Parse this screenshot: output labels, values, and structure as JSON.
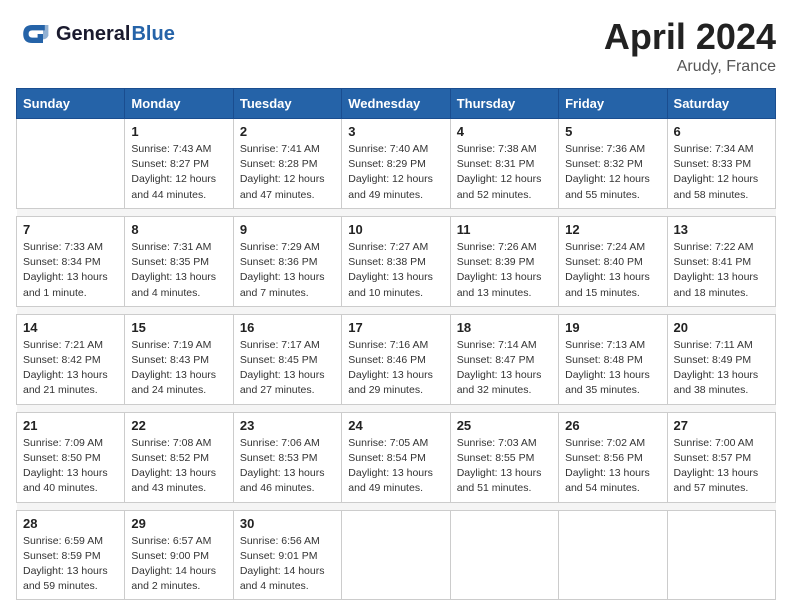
{
  "header": {
    "logo_line1": "General",
    "logo_line2": "Blue",
    "month_year": "April 2024",
    "location": "Arudy, France"
  },
  "weekdays": [
    "Sunday",
    "Monday",
    "Tuesday",
    "Wednesday",
    "Thursday",
    "Friday",
    "Saturday"
  ],
  "weeks": [
    [
      {
        "day": "",
        "sunrise": "",
        "sunset": "",
        "daylight": ""
      },
      {
        "day": "1",
        "sunrise": "Sunrise: 7:43 AM",
        "sunset": "Sunset: 8:27 PM",
        "daylight": "Daylight: 12 hours and 44 minutes."
      },
      {
        "day": "2",
        "sunrise": "Sunrise: 7:41 AM",
        "sunset": "Sunset: 8:28 PM",
        "daylight": "Daylight: 12 hours and 47 minutes."
      },
      {
        "day": "3",
        "sunrise": "Sunrise: 7:40 AM",
        "sunset": "Sunset: 8:29 PM",
        "daylight": "Daylight: 12 hours and 49 minutes."
      },
      {
        "day": "4",
        "sunrise": "Sunrise: 7:38 AM",
        "sunset": "Sunset: 8:31 PM",
        "daylight": "Daylight: 12 hours and 52 minutes."
      },
      {
        "day": "5",
        "sunrise": "Sunrise: 7:36 AM",
        "sunset": "Sunset: 8:32 PM",
        "daylight": "Daylight: 12 hours and 55 minutes."
      },
      {
        "day": "6",
        "sunrise": "Sunrise: 7:34 AM",
        "sunset": "Sunset: 8:33 PM",
        "daylight": "Daylight: 12 hours and 58 minutes."
      }
    ],
    [
      {
        "day": "7",
        "sunrise": "Sunrise: 7:33 AM",
        "sunset": "Sunset: 8:34 PM",
        "daylight": "Daylight: 13 hours and 1 minute."
      },
      {
        "day": "8",
        "sunrise": "Sunrise: 7:31 AM",
        "sunset": "Sunset: 8:35 PM",
        "daylight": "Daylight: 13 hours and 4 minutes."
      },
      {
        "day": "9",
        "sunrise": "Sunrise: 7:29 AM",
        "sunset": "Sunset: 8:36 PM",
        "daylight": "Daylight: 13 hours and 7 minutes."
      },
      {
        "day": "10",
        "sunrise": "Sunrise: 7:27 AM",
        "sunset": "Sunset: 8:38 PM",
        "daylight": "Daylight: 13 hours and 10 minutes."
      },
      {
        "day": "11",
        "sunrise": "Sunrise: 7:26 AM",
        "sunset": "Sunset: 8:39 PM",
        "daylight": "Daylight: 13 hours and 13 minutes."
      },
      {
        "day": "12",
        "sunrise": "Sunrise: 7:24 AM",
        "sunset": "Sunset: 8:40 PM",
        "daylight": "Daylight: 13 hours and 15 minutes."
      },
      {
        "day": "13",
        "sunrise": "Sunrise: 7:22 AM",
        "sunset": "Sunset: 8:41 PM",
        "daylight": "Daylight: 13 hours and 18 minutes."
      }
    ],
    [
      {
        "day": "14",
        "sunrise": "Sunrise: 7:21 AM",
        "sunset": "Sunset: 8:42 PM",
        "daylight": "Daylight: 13 hours and 21 minutes."
      },
      {
        "day": "15",
        "sunrise": "Sunrise: 7:19 AM",
        "sunset": "Sunset: 8:43 PM",
        "daylight": "Daylight: 13 hours and 24 minutes."
      },
      {
        "day": "16",
        "sunrise": "Sunrise: 7:17 AM",
        "sunset": "Sunset: 8:45 PM",
        "daylight": "Daylight: 13 hours and 27 minutes."
      },
      {
        "day": "17",
        "sunrise": "Sunrise: 7:16 AM",
        "sunset": "Sunset: 8:46 PM",
        "daylight": "Daylight: 13 hours and 29 minutes."
      },
      {
        "day": "18",
        "sunrise": "Sunrise: 7:14 AM",
        "sunset": "Sunset: 8:47 PM",
        "daylight": "Daylight: 13 hours and 32 minutes."
      },
      {
        "day": "19",
        "sunrise": "Sunrise: 7:13 AM",
        "sunset": "Sunset: 8:48 PM",
        "daylight": "Daylight: 13 hours and 35 minutes."
      },
      {
        "day": "20",
        "sunrise": "Sunrise: 7:11 AM",
        "sunset": "Sunset: 8:49 PM",
        "daylight": "Daylight: 13 hours and 38 minutes."
      }
    ],
    [
      {
        "day": "21",
        "sunrise": "Sunrise: 7:09 AM",
        "sunset": "Sunset: 8:50 PM",
        "daylight": "Daylight: 13 hours and 40 minutes."
      },
      {
        "day": "22",
        "sunrise": "Sunrise: 7:08 AM",
        "sunset": "Sunset: 8:52 PM",
        "daylight": "Daylight: 13 hours and 43 minutes."
      },
      {
        "day": "23",
        "sunrise": "Sunrise: 7:06 AM",
        "sunset": "Sunset: 8:53 PM",
        "daylight": "Daylight: 13 hours and 46 minutes."
      },
      {
        "day": "24",
        "sunrise": "Sunrise: 7:05 AM",
        "sunset": "Sunset: 8:54 PM",
        "daylight": "Daylight: 13 hours and 49 minutes."
      },
      {
        "day": "25",
        "sunrise": "Sunrise: 7:03 AM",
        "sunset": "Sunset: 8:55 PM",
        "daylight": "Daylight: 13 hours and 51 minutes."
      },
      {
        "day": "26",
        "sunrise": "Sunrise: 7:02 AM",
        "sunset": "Sunset: 8:56 PM",
        "daylight": "Daylight: 13 hours and 54 minutes."
      },
      {
        "day": "27",
        "sunrise": "Sunrise: 7:00 AM",
        "sunset": "Sunset: 8:57 PM",
        "daylight": "Daylight: 13 hours and 57 minutes."
      }
    ],
    [
      {
        "day": "28",
        "sunrise": "Sunrise: 6:59 AM",
        "sunset": "Sunset: 8:59 PM",
        "daylight": "Daylight: 13 hours and 59 minutes."
      },
      {
        "day": "29",
        "sunrise": "Sunrise: 6:57 AM",
        "sunset": "Sunset: 9:00 PM",
        "daylight": "Daylight: 14 hours and 2 minutes."
      },
      {
        "day": "30",
        "sunrise": "Sunrise: 6:56 AM",
        "sunset": "Sunset: 9:01 PM",
        "daylight": "Daylight: 14 hours and 4 minutes."
      },
      {
        "day": "",
        "sunrise": "",
        "sunset": "",
        "daylight": ""
      },
      {
        "day": "",
        "sunrise": "",
        "sunset": "",
        "daylight": ""
      },
      {
        "day": "",
        "sunrise": "",
        "sunset": "",
        "daylight": ""
      },
      {
        "day": "",
        "sunrise": "",
        "sunset": "",
        "daylight": ""
      }
    ]
  ]
}
